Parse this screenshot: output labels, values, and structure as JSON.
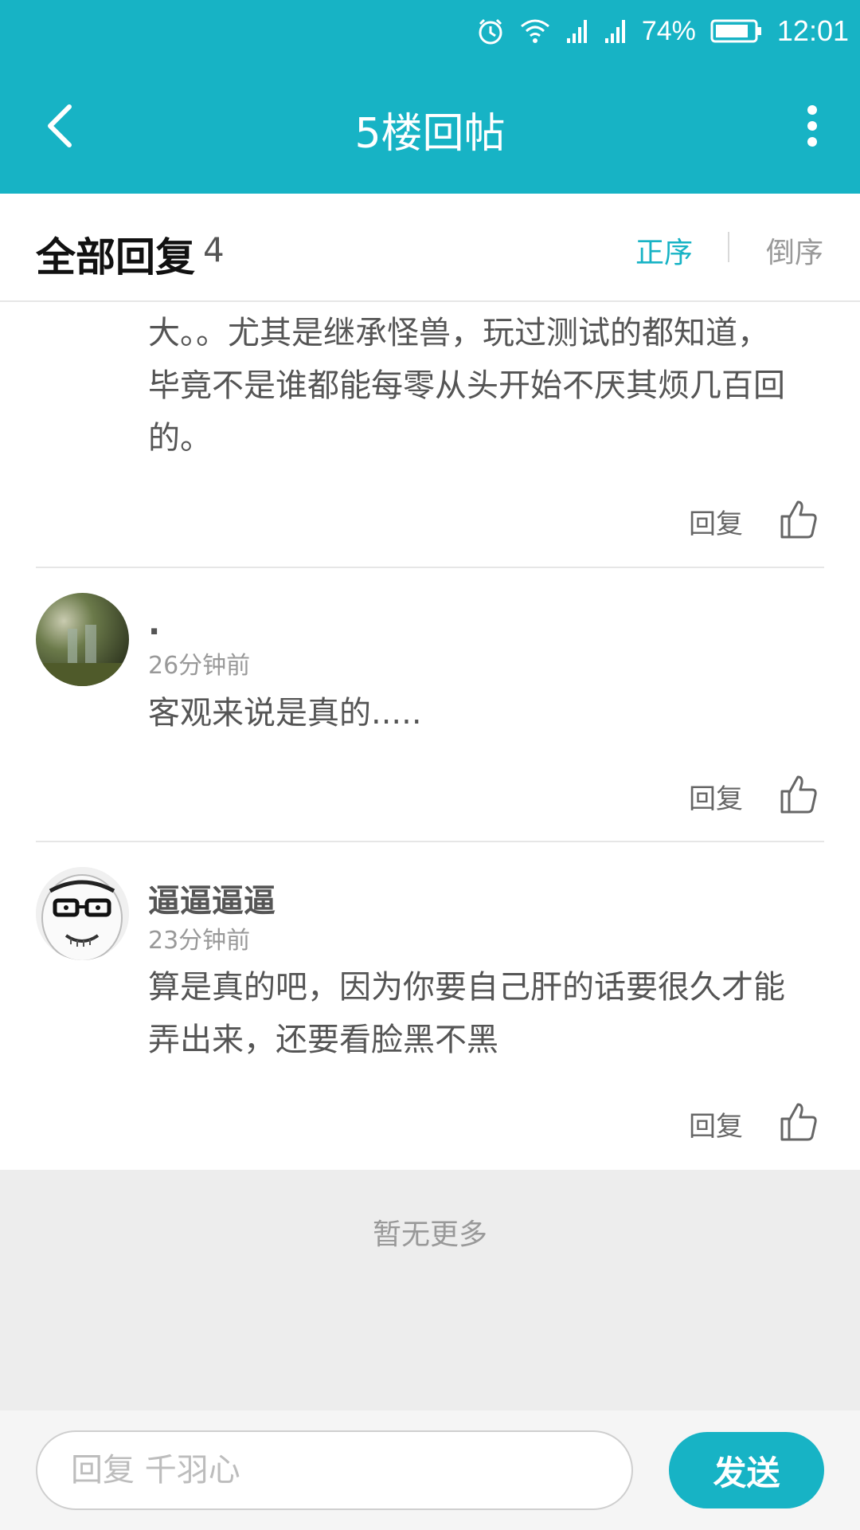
{
  "status_bar": {
    "battery_percent": "74%",
    "time": "12:01",
    "icons": [
      "alarm-icon",
      "wifi-icon",
      "signal-icon",
      "signal-icon",
      "battery-icon"
    ]
  },
  "app_bar": {
    "title": "5楼回帖",
    "back_icon": "back-arrow-icon",
    "more_icon": "more-vertical-icon"
  },
  "reply_header": {
    "label": "全部回复",
    "count": "4",
    "sort_asc": "正序",
    "sort_desc": "倒序"
  },
  "comments": [
    {
      "text_lines": [
        "大。。尤其是继承怪兽，玩过测试的都知道，",
        "毕竟不是谁都能每零从头开始不厌其烦几百回",
        "的。"
      ],
      "reply_label": "回复"
    },
    {
      "author": ".",
      "time": "26分钟前",
      "text_lines": [
        "客观来说是真的....."
      ],
      "reply_label": "回复"
    },
    {
      "author": "逼逼逼逼",
      "time": "23分钟前",
      "text_lines": [
        "算是真的吧，因为你要自己肝的话要很久才能",
        "弄出来，还要看脸黑不黑"
      ],
      "reply_label": "回复"
    }
  ],
  "no_more_text": "暂无更多",
  "bottom_bar": {
    "input_placeholder": "回复 千羽心",
    "send_label": "发送"
  },
  "colors": {
    "accent": "#17b3c5",
    "background_gray": "#ededed"
  }
}
